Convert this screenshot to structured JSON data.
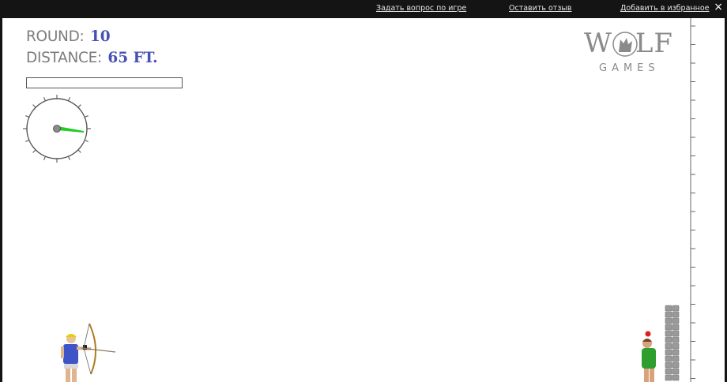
{
  "topbar": {
    "links": [
      "Задать вопрос по игре",
      "Оставить отзыв",
      "Добавить в избранное"
    ],
    "close": "×"
  },
  "hud": {
    "round_label": "ROUND:",
    "round_value": "10",
    "distance_label": "DISTANCE:",
    "distance_value": "65 FT."
  },
  "power": {
    "level": 0
  },
  "logo": {
    "word": "WOLF",
    "sub": "GAMES"
  },
  "colors": {
    "hud_value": "#4651b4",
    "hud_label": "#7d7d7d",
    "wind_needle": "#22cc22",
    "background": "#ffffff"
  },
  "icons": [
    "close-icon",
    "wind-dial-icon",
    "archer-sprite",
    "target-person-sprite",
    "apple-icon",
    "stone-wall"
  ]
}
